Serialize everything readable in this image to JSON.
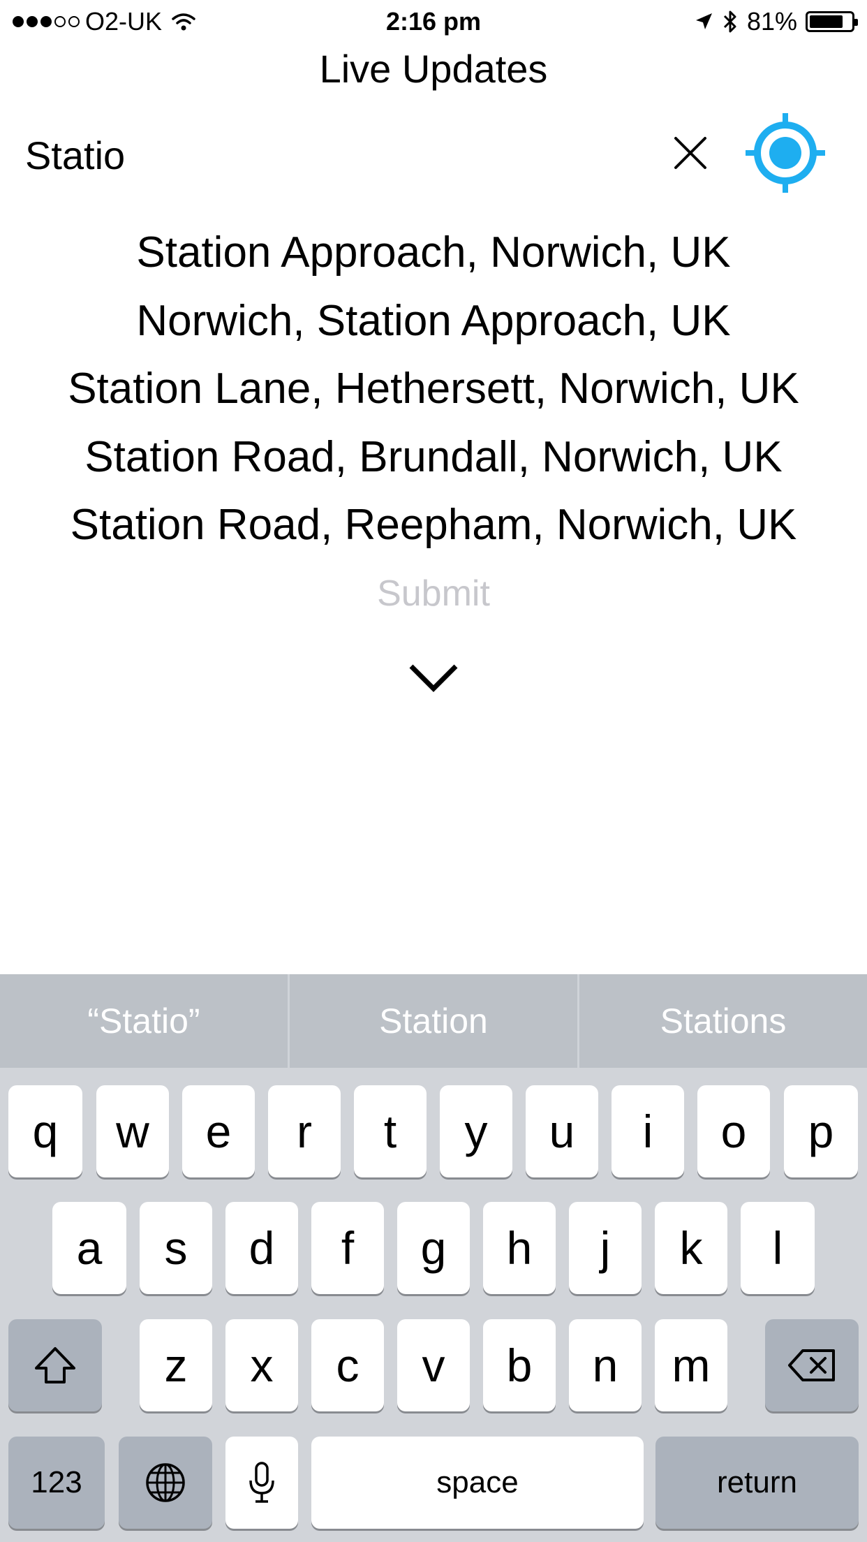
{
  "status_bar": {
    "carrier": "O2-UK",
    "time": "2:16 pm",
    "battery": "81%",
    "signal_bars": 3,
    "signal_total": 5,
    "battery_level": 0.81
  },
  "header": {
    "title": "Live Updates"
  },
  "search": {
    "value": "Statio"
  },
  "suggestions": [
    "Station Approach, Norwich, UK",
    "Norwich, Station Approach, UK",
    "Station Lane, Hethersett, Norwich, UK",
    "Station Road, Brundall, Norwich, UK",
    "Station Road, Reepham, Norwich, UK"
  ],
  "submit_label": "Submit",
  "colors": {
    "accent": "#1eaef0",
    "disabled_text": "#c7c7cc"
  },
  "keyboard": {
    "predictive": [
      "“Statio”",
      "Station",
      "Stations"
    ],
    "row1": [
      "q",
      "w",
      "e",
      "r",
      "t",
      "y",
      "u",
      "i",
      "o",
      "p"
    ],
    "row2": [
      "a",
      "s",
      "d",
      "f",
      "g",
      "h",
      "j",
      "k",
      "l"
    ],
    "row3": [
      "z",
      "x",
      "c",
      "v",
      "b",
      "n",
      "m"
    ],
    "numbers_label": "123",
    "space_label": "space",
    "return_label": "return"
  }
}
